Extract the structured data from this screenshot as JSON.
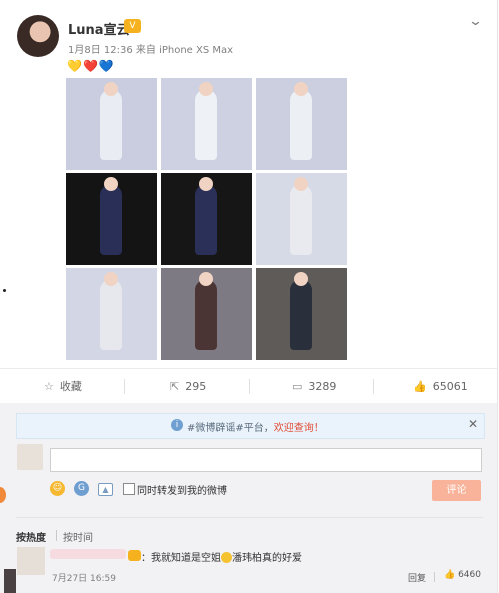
{
  "post": {
    "username": "Luna宣云",
    "badge": "V",
    "meta": "1月8日 12:36 来自 iPhone XS Max",
    "hearts": "💛❤️💙",
    "photos": [
      {
        "bg": "#c9cddf",
        "fig": "#e9edf3"
      },
      {
        "bg": "#cdd1e1",
        "fig": "#eef1f5"
      },
      {
        "bg": "#cbcfe0",
        "fig": "#eceff4"
      },
      {
        "bg": "#141414",
        "fig": "#2a2f57"
      },
      {
        "bg": "#161616",
        "fig": "#2b3058"
      },
      {
        "bg": "#d6d9e6",
        "fig": "#e9eaef"
      },
      {
        "bg": "#d3d7e5",
        "fig": "#e6e8ee"
      },
      {
        "bg": "#7d7a84",
        "fig": "#4a3434"
      },
      {
        "bg": "#5f5b58",
        "fig": "#2a2f3c"
      }
    ]
  },
  "actions": {
    "favorite": "收藏",
    "repost": "295",
    "comment": "3289",
    "like": "65061"
  },
  "notice": {
    "prefix": "#微博辟谣#平台，",
    "highlight": "欢迎查询！"
  },
  "compose": {
    "checkbox_label": "同时转发到我的微博",
    "submit": "评论"
  },
  "sort": {
    "hot": "按热度",
    "time": "按时间"
  },
  "comment": {
    "text_a": "：我就知道是空姐",
    "text_b": "潘玮柏真的好爱",
    "time": "7月27日 16:59",
    "reply": "回复",
    "likes": "6460"
  }
}
